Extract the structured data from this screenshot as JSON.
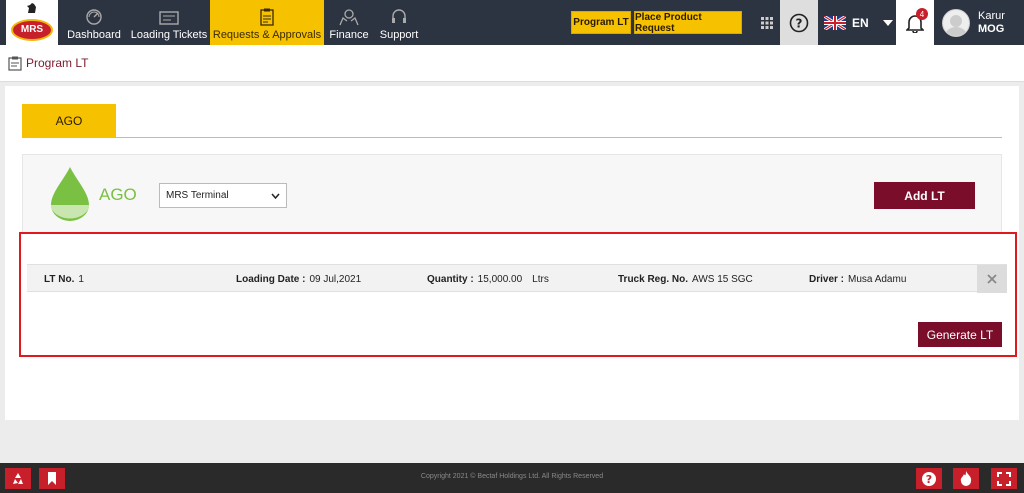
{
  "header": {
    "logo_text": "MRS",
    "nav": [
      {
        "label": "Dashboard",
        "icon": "dashboard-icon"
      },
      {
        "label": "Loading Tickets",
        "icon": "ticket-icon"
      },
      {
        "label": "Requests & Approvals",
        "icon": "clipboard-icon",
        "active": true
      },
      {
        "label": "Finance",
        "icon": "money-hands-icon"
      },
      {
        "label": "Support",
        "icon": "headset-icon"
      }
    ],
    "program_lt_btn": "Program LT",
    "place_request_btn": "Place Product Request",
    "language": "EN",
    "notifications_count": "4",
    "user_name": "Karur",
    "user_org": "MOG"
  },
  "breadcrumb": {
    "title": "Program LT"
  },
  "tab": {
    "label": "AGO"
  },
  "product": {
    "name": "AGO",
    "terminal": "MRS Terminal",
    "add_lt": "Add LT"
  },
  "lt_row": {
    "lt_no_label": "LT No.",
    "lt_no": "1",
    "loading_date_label": "Loading Date :",
    "loading_date": "09 Jul,2021",
    "quantity_label": "Quantity :",
    "quantity": "15,000.00",
    "quantity_unit": "Ltrs",
    "truck_label": "Truck Reg. No.",
    "truck": "AWS 15 SGC",
    "driver_label": "Driver :",
    "driver": "Musa Adamu"
  },
  "generate_lt": "Generate LT",
  "footer": {
    "copyright": "Copyright 2021 © Bectaf Holdings Ltd. All Rights Reserved"
  },
  "colors": {
    "brand_maroon": "#7a0e2a",
    "accent_yellow": "#f6c200",
    "topbar": "#2d3441",
    "highlight_red": "#e0181f",
    "product_green": "#7ac143"
  }
}
